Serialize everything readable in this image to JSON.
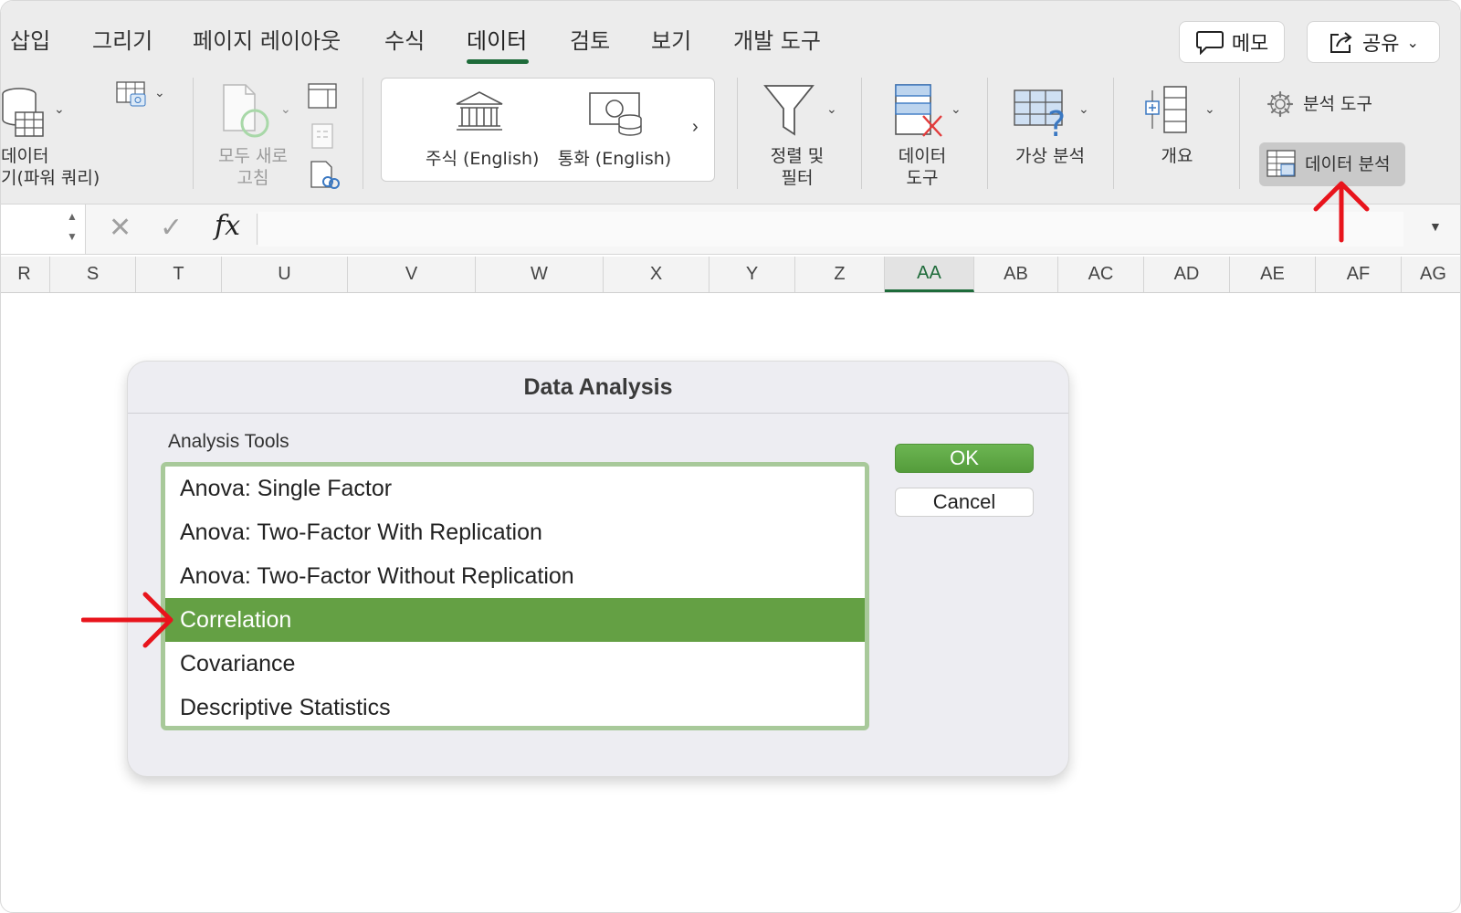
{
  "ribbon": {
    "tabs": [
      {
        "label": "삽입"
      },
      {
        "label": "그리기"
      },
      {
        "label": "페이지 레이아웃"
      },
      {
        "label": "수식"
      },
      {
        "label": "데이터",
        "active": true
      },
      {
        "label": "검토"
      },
      {
        "label": "보기"
      },
      {
        "label": "개발 도구"
      }
    ],
    "memo_label": "메모",
    "share_label": "공유",
    "get_data_label_1": "데이터",
    "get_data_label_2": "기(파워 쿼리)",
    "refresh_all_label_1": "모두 새로",
    "refresh_all_label_2": "고침",
    "stocks_label": "주식 (English)",
    "currencies_label": "통화 (English)",
    "sort_filter_label_1": "정렬 및",
    "sort_filter_label_2": "필터",
    "data_tools_label_1": "데이터",
    "data_tools_label_2": "도구",
    "what_if_label": "가상 분석",
    "outline_label": "개요",
    "analysis_tools_label": "분석 도구",
    "data_analysis_label": "데이터 분석"
  },
  "formula_bar": {
    "cancel_glyph": "✕",
    "enter_glyph": "✓",
    "fx_label": "fx"
  },
  "columns": [
    "R",
    "S",
    "T",
    "U",
    "V",
    "W",
    "X",
    "Y",
    "Z",
    "AA",
    "AB",
    "AC",
    "AD",
    "AE",
    "AF",
    "AG"
  ],
  "selected_column": "AA",
  "dialog": {
    "title": "Data Analysis",
    "tools_label": "Analysis Tools",
    "items": [
      "Anova: Single Factor",
      "Anova: Two-Factor With Replication",
      "Anova: Two-Factor Without Replication",
      "Correlation",
      "Covariance",
      "Descriptive Statistics"
    ],
    "selected_item": "Correlation",
    "ok_label": "OK",
    "cancel_label": "Cancel"
  },
  "colors": {
    "accent_green": "#1e6b3a",
    "selection_green": "#64a044",
    "annotation_red": "#e8141c"
  }
}
